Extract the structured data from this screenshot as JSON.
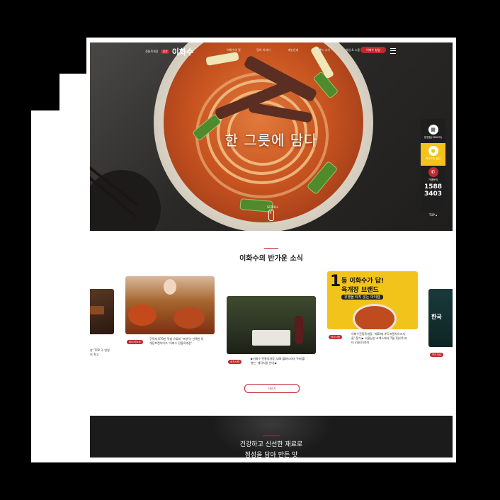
{
  "header": {
    "logo_small": "전통육개장",
    "logo_badge": "전문",
    "logo_name": "이화수",
    "nav": [
      "이화수의 맛",
      "맛의 이야기",
      "메뉴안내",
      "브랜드 소식",
      "창업 & 소통"
    ],
    "join_label": "이화수 창업",
    "menu_icon": "hamburger-icon"
  },
  "hero": {
    "title": "한 그릇에 담다",
    "scroll_label": "SCROLL"
  },
  "quick_menu": {
    "items": [
      {
        "icon": "store-icon",
        "label": "창업점(1800이)"
      },
      {
        "icon": "chat-icon",
        "label": "카카오톡 상담"
      },
      {
        "icon": "phone-icon",
        "label": "가맹문의"
      }
    ],
    "phone_1": "1588",
    "phone_2": "3403",
    "top_label": "TOP ▴"
  },
  "news": {
    "title": "이화수의 반가운 소식",
    "cards": [
      {
        "badge": "",
        "text": "양' TOP 3, 연령\n의 최고"
      },
      {
        "badge": "미디어소개",
        "text": "구독자 670만 먹방 유튜버 '쯔양'이 선택한 육\n개장프랜차이즈 '이화수 전통육개장'"
      },
      {
        "badge": "공지사항",
        "text": "▶이화수 전통육개장, tvN 월화드라마 '취미를\n쌓는' 제작지원 안내◀"
      },
      {
        "badge": "공지사항",
        "text": "이화수전통육개장, '제50회 #도프랜차이즈서\n울' 참가 ▶ 서울삼성 코엑스에서 7월 1일(목)부\n터 3일(토)까지"
      },
      {
        "badge": "보도자료",
        "text": ""
      }
    ],
    "promo": {
      "rank": "1",
      "line1": "등 이화수가 답!",
      "line2": "육개장 브랜드",
      "line3": "유행을 타지 않는 아이템"
    },
    "edge_card_text": "한국",
    "more_label": "더보기"
  },
  "bottom": {
    "line1": "건강하고 신선한 재료로",
    "line2": "정성을 담아 만든 맛"
  },
  "colors": {
    "brand_red": "#c0282d",
    "background": "#000000",
    "promo_yellow": "#f2c31a"
  }
}
